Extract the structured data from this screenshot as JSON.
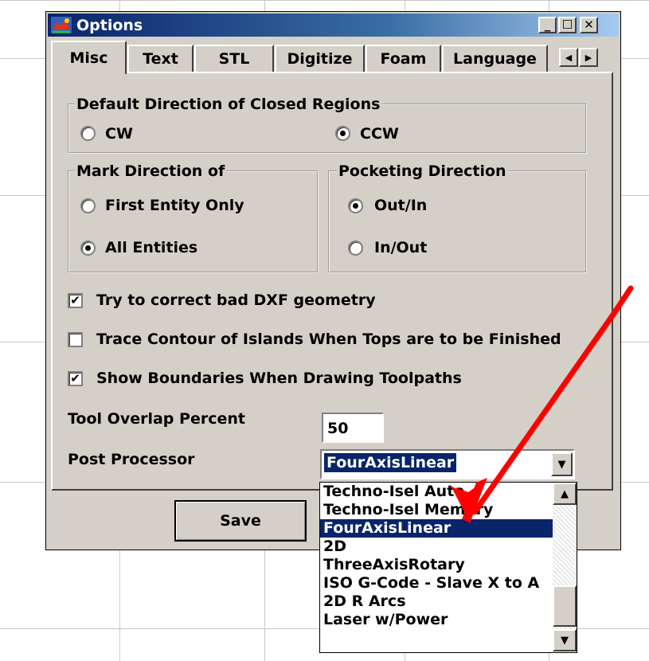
{
  "window": {
    "title": "Options",
    "caption_buttons": {
      "minimize": "_",
      "maximize": "☐",
      "close": "✕"
    }
  },
  "tabs": [
    "Misc",
    "Text",
    "STL",
    "Digitize",
    "Foam",
    "Language"
  ],
  "tab_scroll": {
    "left": "◀",
    "right": "▶"
  },
  "closed_regions": {
    "legend": "Default Direction of Closed Regions",
    "options": [
      "CW",
      "CCW"
    ],
    "selected": "CCW"
  },
  "mark_direction": {
    "legend": "Mark Direction of",
    "options": [
      "First Entity Only",
      "All Entities"
    ],
    "selected": "All Entities"
  },
  "pocketing": {
    "legend": "Pocketing Direction",
    "options": [
      "Out/In",
      "In/Out"
    ],
    "selected": "Out/In"
  },
  "checkboxes": [
    {
      "label": "Try to correct bad DXF geometry",
      "checked": true,
      "mark": "✔"
    },
    {
      "label": "Trace Contour of Islands When Tops are to be Finished",
      "checked": false,
      "mark": ""
    },
    {
      "label": "Show Boundaries When Drawing Toolpaths",
      "checked": true,
      "mark": "✔"
    }
  ],
  "tool_overlap": {
    "label": "Tool Overlap Percent",
    "value": "50"
  },
  "post_processor": {
    "label": "Post Processor",
    "value": "FourAxisLinear",
    "options": [
      "Techno-Isel Auto",
      "Techno-Isel Memory",
      "FourAxisLinear",
      "2D",
      "ThreeAxisRotary",
      "ISO G-Code - Slave X to A",
      "2D R Arcs",
      "Laser w/Power"
    ],
    "highlighted": "FourAxisLinear",
    "arrow_down": "▼",
    "arrow_up": "▲"
  },
  "buttons": {
    "save": "Save"
  },
  "colors": {
    "face": "#d4d0c8",
    "title_bar": "#0a246a",
    "selection": "#0a246a",
    "annotation_arrow": "#ff0000"
  }
}
